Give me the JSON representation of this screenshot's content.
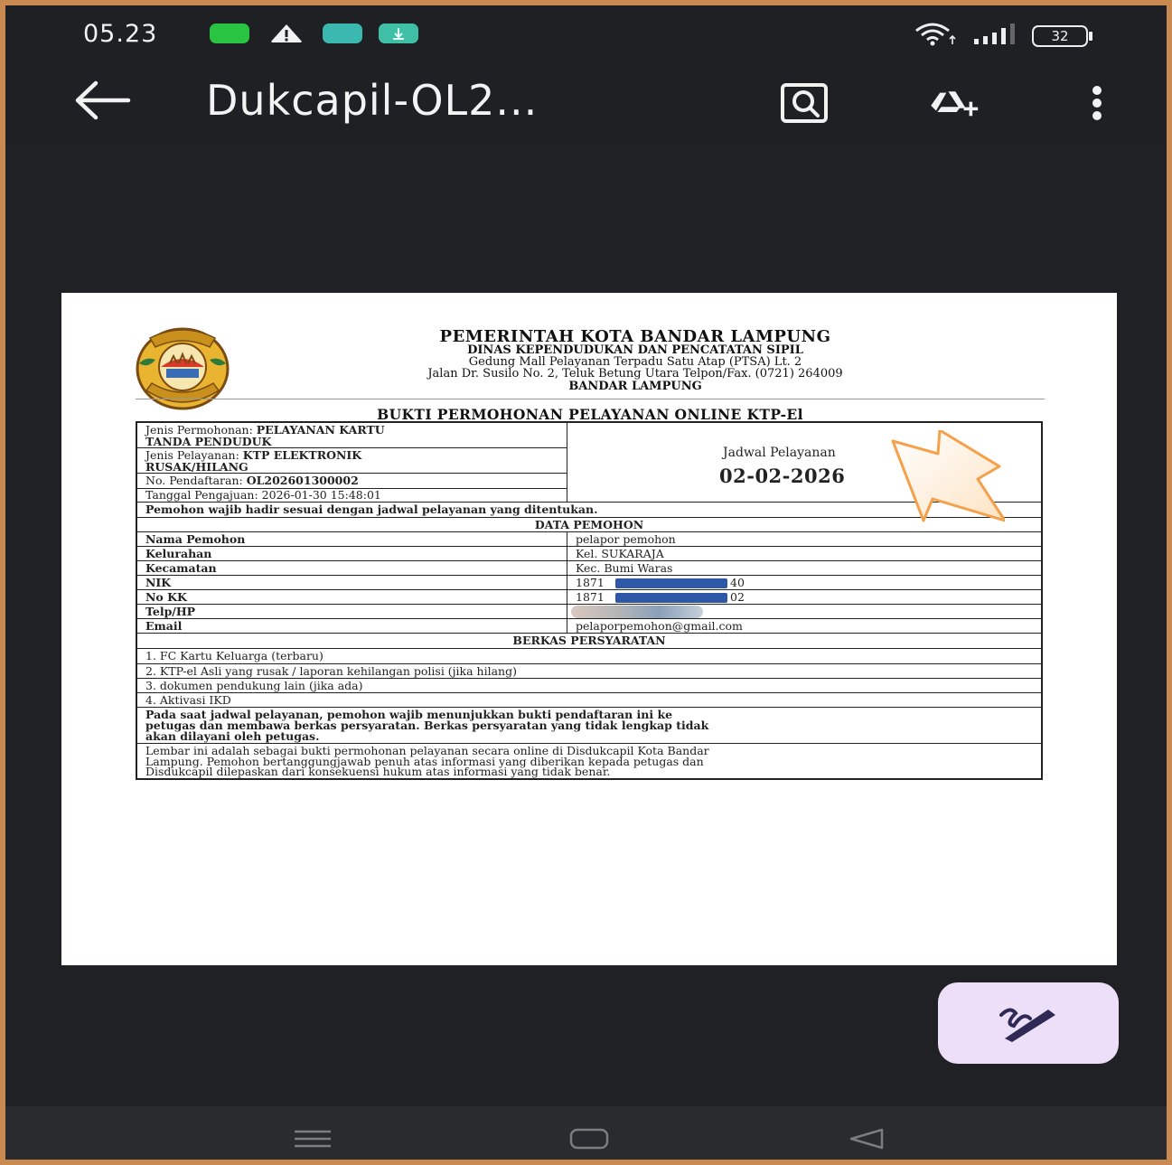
{
  "status_bar": {
    "time": "05.23",
    "battery": "32",
    "icons": [
      "app-notification-icon",
      "warning-icon",
      "app-notification-icon",
      "download-icon",
      "wifi-icon",
      "signal-icon",
      "battery-icon"
    ]
  },
  "app_bar": {
    "title": "Dukcapil-OL2...",
    "icons": [
      "back-arrow-icon",
      "find-in-page-icon",
      "add-to-drive-icon",
      "more-vert-icon"
    ]
  },
  "document": {
    "header": {
      "line1": "PEMERINTAH KOTA BANDAR LAMPUNG",
      "line2": "DINAS KEPENDUDUKAN DAN PENCATATAN SIPIL",
      "line3": "Gedung Mall Pelayanan Terpadu Satu Atap (PTSA) Lt. 2",
      "line4": "Jalan Dr. Susilo No. 2, Teluk Betung Utara Telpon/Fax. (0721) 264009",
      "line5": "BANDAR LAMPUNG",
      "logo_text_top": "KOTA",
      "logo_text_bottom": "BANDAR LAMPUNG"
    },
    "title": "BUKTI PERMOHONAN PELAYANAN ONLINE KTP-El",
    "info": {
      "jenis_permohonan_label": "Jenis Permohonan: ",
      "jenis_permohonan_value_1": "PELAYANAN KARTU",
      "jenis_permohonan_value_2": "TANDA PENDUDUK",
      "jenis_pelayanan_label": "Jenis Pelayanan: ",
      "jenis_pelayanan_value_1": "KTP ELEKTRONIK",
      "jenis_pelayanan_value_2": "RUSAK/HILANG",
      "no_pendaftaran_label": "No. Pendaftaran: ",
      "no_pendaftaran_value": "OL202601300002",
      "tanggal_pengajuan": "Tanggal Pengajuan: 2026-01-30 15:48:01"
    },
    "schedule": {
      "label": "Jadwal Pelayanan",
      "date": "02-02-2026"
    },
    "notice": "Pemohon wajib hadir sesuai dengan jadwal pelayanan yang ditentukan.",
    "data_pemohon": {
      "heading": "DATA PEMOHON",
      "rows": [
        {
          "label": "Nama Pemohon",
          "value": "pelapor pemohon"
        },
        {
          "label": "Kelurahan",
          "value": "Kel. SUKARAJA"
        },
        {
          "label": "Kecamatan",
          "value": "Kec. Bumi Waras"
        },
        {
          "label": "NIK",
          "value_prefix": "1871",
          "value_suffix": "40"
        },
        {
          "label": "No KK",
          "value_prefix": "1871",
          "value_suffix": "02"
        },
        {
          "label": "Telp/HP",
          "value": ""
        },
        {
          "label": "Email",
          "value": "pelaporpemohon@gmail.com"
        }
      ]
    },
    "berkas": {
      "heading": "BERKAS PERSYARATAN",
      "items": [
        "1. FC Kartu Keluarga (terbaru)",
        "2. KTP-el Asli yang rusak / laporan kehilangan polisi (jika hilang)",
        "3. dokumen pendukung lain (jika ada)",
        "4. Aktivasi IKD"
      ]
    },
    "instruction": [
      "Pada saat jadwal pelayanan, pemohon wajib menunjukkan bukti pendaftaran ini ke",
      "petugas dan membawa berkas persyaratan. Berkas persyaratan yang tidak lengkap tidak",
      "akan dilayani oleh petugas."
    ],
    "disclaimer": [
      "Lembar ini adalah sebagai bukti permohonan pelayanan secara online di Disdukcapil Kota Bandar",
      "Lampung. Pemohon bertanggungjawab penuh atas informasi yang diberikan kepada petugas dan",
      "Disdukcapil dilepaskan dari konsekuensi hukum atas informasi yang tidak benar."
    ]
  },
  "fab": {
    "icon": "annotate-pen-icon"
  },
  "nav_bar": {
    "icons": [
      "recent-apps-icon",
      "home-icon",
      "back-icon"
    ]
  },
  "colors": {
    "frame": "#c98a52",
    "background": "#1f2023",
    "fab": "#ecdff7",
    "arrow_annotation": "#f5a04a",
    "redaction": "#2e57a6"
  }
}
